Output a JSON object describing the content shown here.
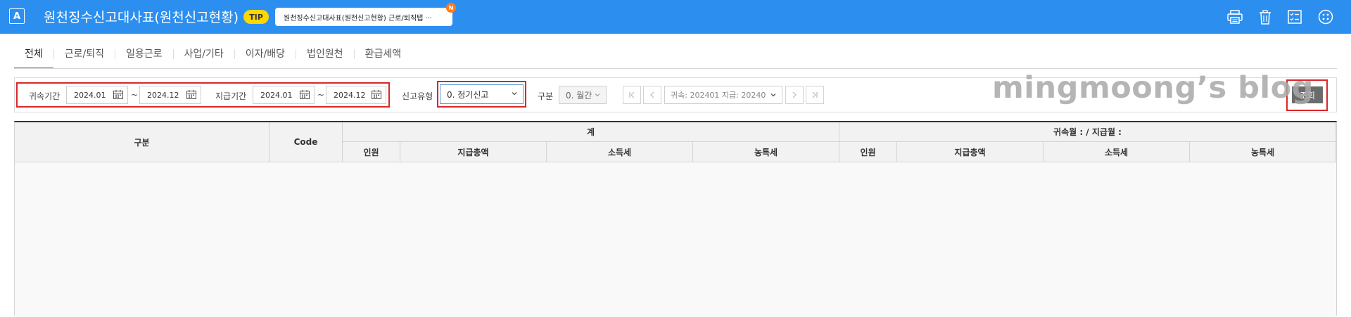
{
  "header": {
    "app_badge": "A",
    "title": "원천징수신고대사표(원천신고현황)",
    "tip_label": "TIP",
    "tip_text": "원천징수신고대사표(원천신고현황) 근로/퇴직탭 ···",
    "new_badge": "N",
    "icons": [
      "print-icon",
      "trash-icon",
      "checklist-icon",
      "more-icon"
    ]
  },
  "tabs": [
    {
      "label": "전체",
      "active": true
    },
    {
      "label": "근로/퇴직",
      "active": false
    },
    {
      "label": "일용근로",
      "active": false
    },
    {
      "label": "사업/기타",
      "active": false
    },
    {
      "label": "이자/배당",
      "active": false
    },
    {
      "label": "법인원천",
      "active": false
    },
    {
      "label": "환급세액",
      "active": false
    }
  ],
  "filters": {
    "belong_period_label": "귀속기간",
    "belong_from": "2024.01",
    "belong_to": "2024.12",
    "tilde": "~",
    "pay_period_label": "지급기간",
    "pay_from": "2024.01",
    "pay_to": "2024.12",
    "report_type_label": "신고유형",
    "report_type_value": "0. 정기신고",
    "division_label": "구분",
    "division_value": "0. 월간",
    "period_value": "귀속: 202401 지급: 20240",
    "search_button": "조회"
  },
  "watermark": "mingmoong’s blog",
  "table": {
    "col_group": "구분",
    "col_code": "Code",
    "group_total": "계",
    "group_month": "귀속월 : / 지급월 :",
    "sub_cols": [
      "인원",
      "지급총액",
      "소득세",
      "농특세"
    ]
  },
  "colors": {
    "header_bg": "#2c8ff0",
    "highlight_red": "#d9262c",
    "tip_yellow": "#ffd600"
  }
}
